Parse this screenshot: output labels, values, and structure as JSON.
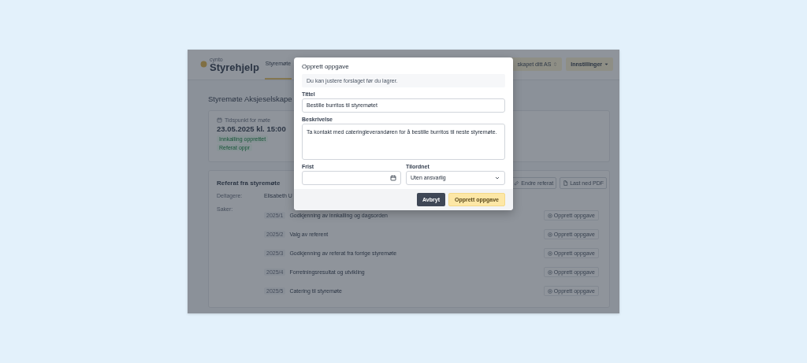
{
  "app": {
    "logo": {
      "tagline": "cynto",
      "name": "Styrehjelp"
    },
    "nav": [
      {
        "label": "Styremøte",
        "selected": true
      }
    ],
    "company_selector": "skapet ditt AS",
    "settings_button": "Innstillinger",
    "page_title": "Styremøte Aksjeselskape",
    "meeting_card": {
      "label": "Tidspunkt for møte",
      "datetime": "23.05.2025 kl. 15:00",
      "badges": [
        "Innkalling opprettet",
        "Referat oppr"
      ]
    },
    "minutes": {
      "title": "Referat fra styremøte",
      "buttons": [
        "Endre referat",
        "Last ned PDF"
      ],
      "participants_label": "Deltagere:",
      "participants": "Elisabeth U",
      "items_label": "Saker:",
      "items": [
        {
          "number": "2025/1",
          "title": "Godkjenning av innkalling og dagsorden",
          "action": "Opprett oppgave"
        },
        {
          "number": "2025/2",
          "title": "Valg av referent",
          "action": "Opprett oppgave"
        },
        {
          "number": "2025/3",
          "title": "Godkjenning av referat fra forrige styremøte",
          "action": "Opprett oppgave"
        },
        {
          "number": "2025/4",
          "title": "Forretningsresultat og utvikling",
          "action": "Opprett oppgave"
        },
        {
          "number": "2025/5",
          "title": "Catering til styremøte",
          "action": "Opprett oppgave"
        }
      ]
    }
  },
  "dialog": {
    "title": "Opprett oppgave",
    "info": "Du kan justere forslaget før du lagrer.",
    "fields": [
      {
        "kind": "text",
        "label": "Tittel",
        "value": "Bestille burritos til styremøtet"
      },
      {
        "kind": "textarea",
        "label": "Beskrivelse",
        "value": "Ta kontakt med cateringleverandøren for å bestille burritos til neste styremøte."
      },
      {
        "kind": "date",
        "label": "Frist"
      },
      {
        "kind": "select",
        "label": "Tilordnet",
        "value": "Uten ansvarlig"
      }
    ],
    "buttons": [
      {
        "label": "Avbryt",
        "kind": "secondary"
      },
      {
        "label": "Opprett oppgave",
        "kind": "primary"
      }
    ]
  }
}
